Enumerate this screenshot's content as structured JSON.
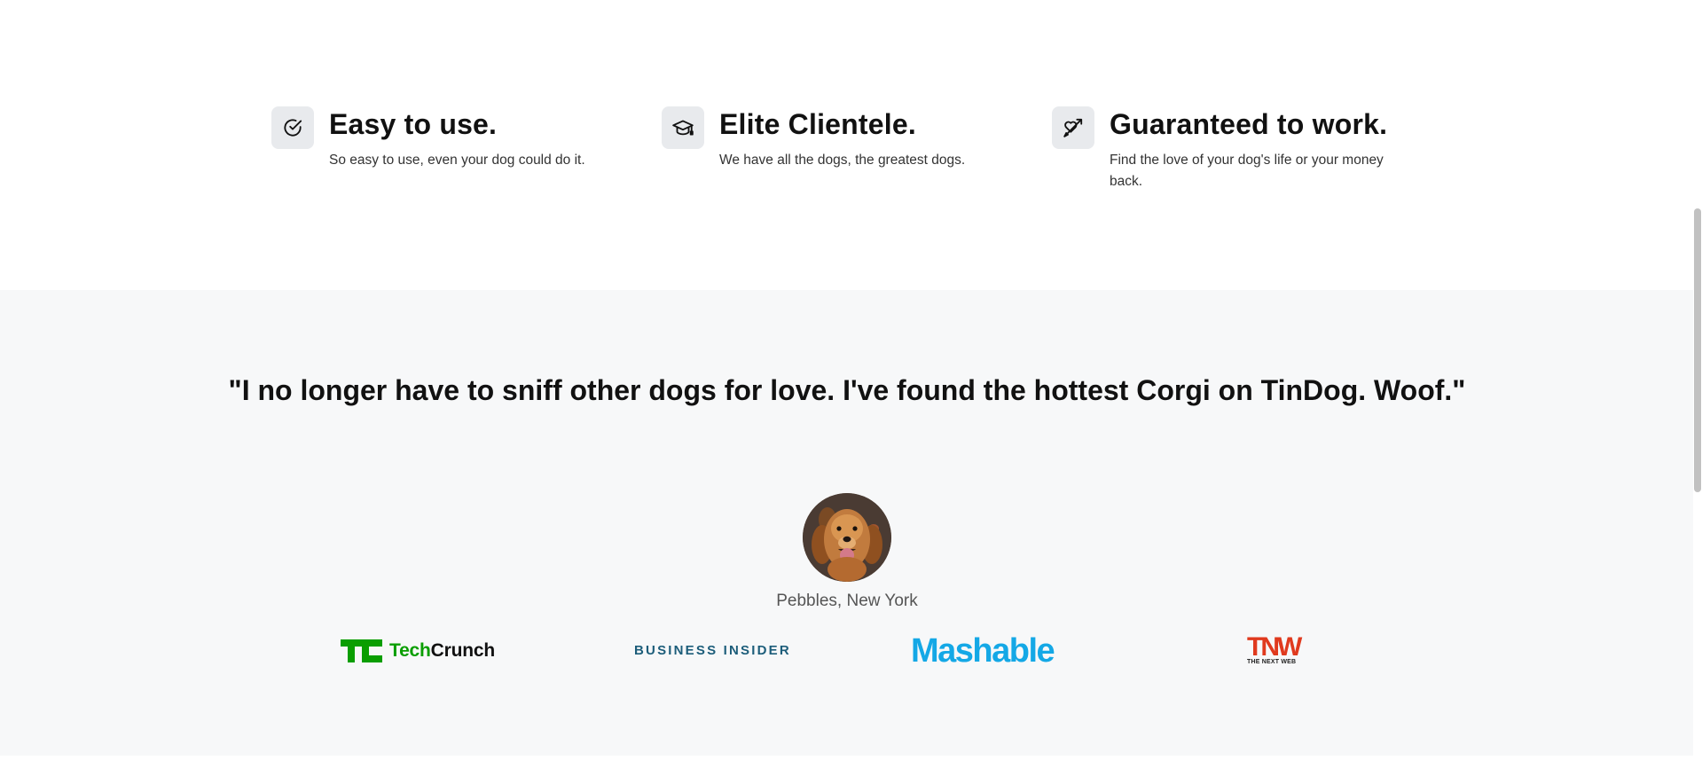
{
  "features": [
    {
      "icon": "check-circle-icon",
      "title": "Easy to use.",
      "text": "So easy to use, even your dog could do it."
    },
    {
      "icon": "graduation-cap-icon",
      "title": "Elite Clientele.",
      "text": "We have all the dogs, the greatest dogs."
    },
    {
      "icon": "heart-arrow-icon",
      "title": "Guaranteed to work.",
      "text": "Find the love of your dog's life or your money back."
    }
  ],
  "testimonial": {
    "quote": "\"I no longer have to sniff other dogs for love. I've found the hottest Corgi on TinDog. Woof.\"",
    "author": "Pebbles, New York"
  },
  "press": {
    "techcrunch": {
      "prefix": "Tech",
      "suffix": "Crunch"
    },
    "business_insider": "BUSINESS INSIDER",
    "mashable": "Mashable",
    "tnw": {
      "main": "TNW",
      "sub": "THE NEXT WEB"
    }
  },
  "colors": {
    "section_bg": "#f7f8f9",
    "icon_bg": "#e8eaed",
    "techcrunch_green": "#0a9e01",
    "business_insider_blue": "#1c5d7a",
    "mashable_blue": "#14a8e6",
    "tnw_red": "#e03a1e"
  }
}
